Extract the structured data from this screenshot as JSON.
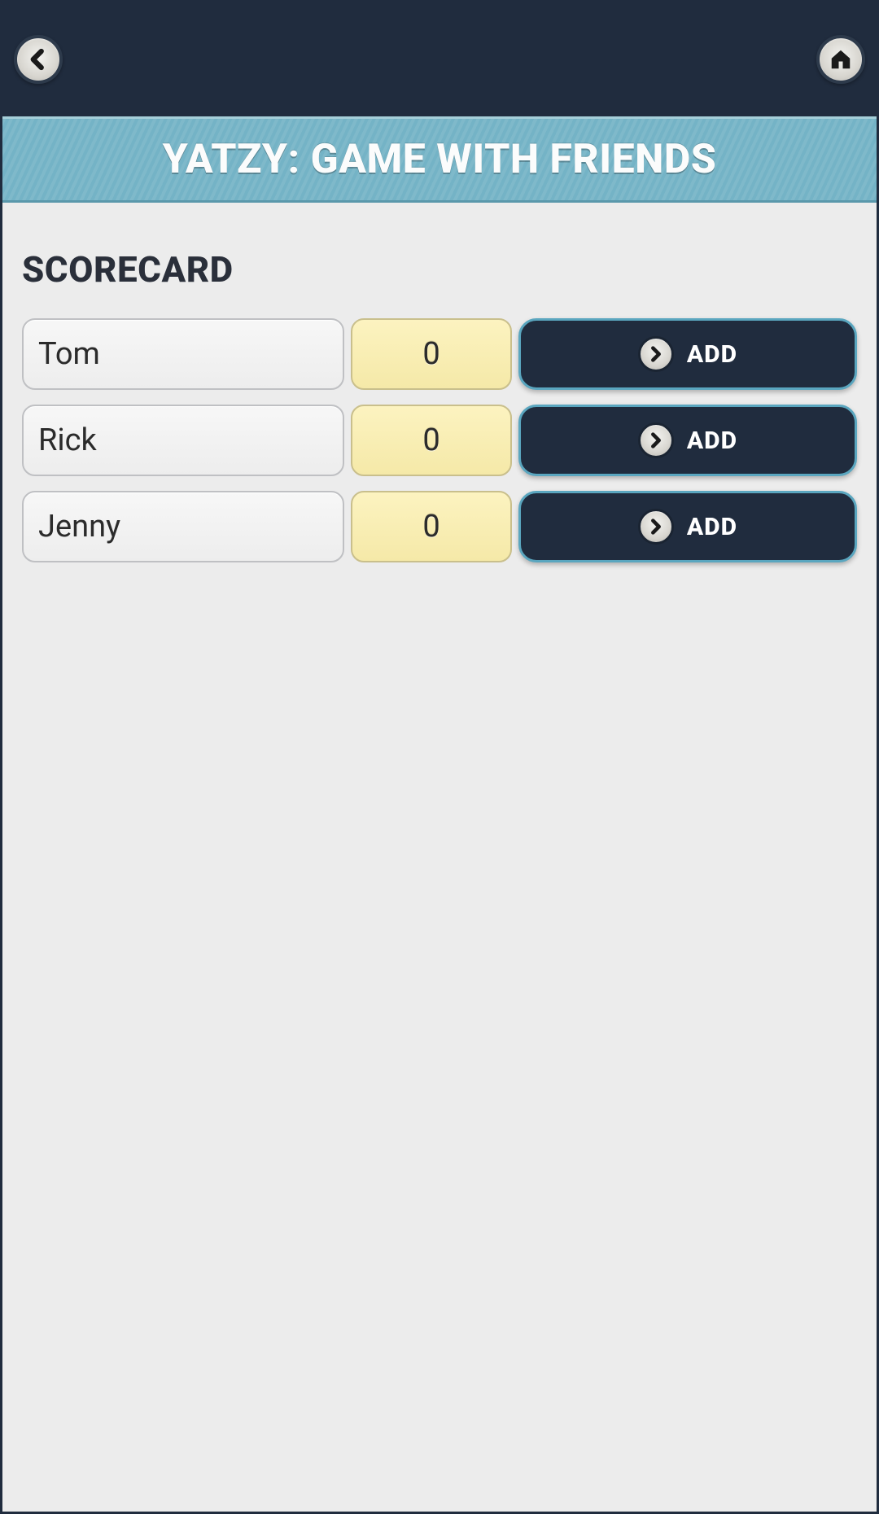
{
  "header": {
    "title": "YATZY: GAME WITH FRIENDS"
  },
  "section": {
    "title": "SCORECARD"
  },
  "players": [
    {
      "name": "Tom",
      "score": "0",
      "add_label": "ADD"
    },
    {
      "name": "Rick",
      "score": "0",
      "add_label": "ADD"
    },
    {
      "name": "Jenny",
      "score": "0",
      "add_label": "ADD"
    }
  ]
}
